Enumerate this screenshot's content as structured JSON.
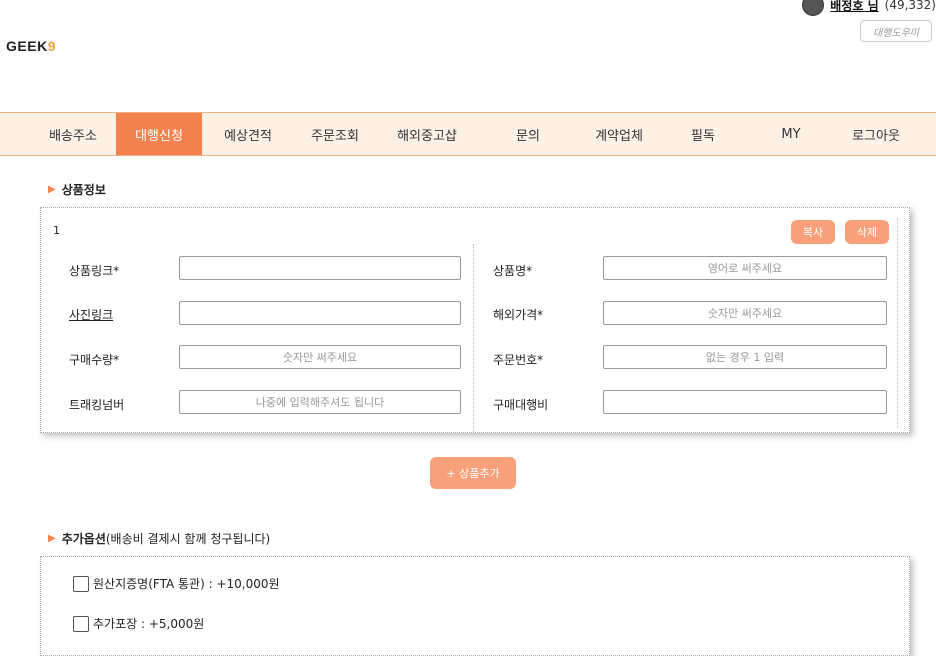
{
  "header": {
    "user_name": "배정호 님",
    "points": "(49,332)",
    "helper_button": "대행도우미",
    "logo_text": "GEEK",
    "logo_accent": "9"
  },
  "nav": {
    "items": [
      "배송주소",
      "대행신청",
      "예상견적",
      "주문조회",
      "해외중고샵",
      "문의",
      "계약업체",
      "필독",
      "MY",
      "로그아웃"
    ],
    "active": "대행신청"
  },
  "product_section": {
    "title": "상품정보",
    "item_number": "1",
    "copy_button": "복사",
    "delete_button": "삭제",
    "fields": {
      "product_link": {
        "label": "상품링크*",
        "placeholder": ""
      },
      "photo_link": {
        "label": "사진링크",
        "placeholder": ""
      },
      "quantity": {
        "label": "구매수량*",
        "placeholder": "숫자만 써주세요"
      },
      "tracking": {
        "label": "트래킹넘버",
        "placeholder": "나중에 입력해주셔도 됩니다"
      },
      "product_name": {
        "label": "상품명*",
        "placeholder": "영어로 써주세요"
      },
      "overseas_price": {
        "label": "해외가격*",
        "placeholder": "숫자만 써주세요"
      },
      "order_number": {
        "label": "주문번호*",
        "placeholder": "없는 경우 1 입력"
      },
      "agency_fee": {
        "label": "구매대행비",
        "placeholder": ""
      }
    },
    "add_button": "+ 상품추가"
  },
  "options_section": {
    "title": "추가옵션",
    "note": "(배송비 결제시 함께 청구됩니다)",
    "options": [
      "원산지증명(FTA 통관) : +10,000원",
      "추가포장 : +5,000원"
    ]
  },
  "colors": {
    "accent": "#f4824f",
    "accent_light": "#f9a07a",
    "nav_bg": "#fdf1e6"
  }
}
